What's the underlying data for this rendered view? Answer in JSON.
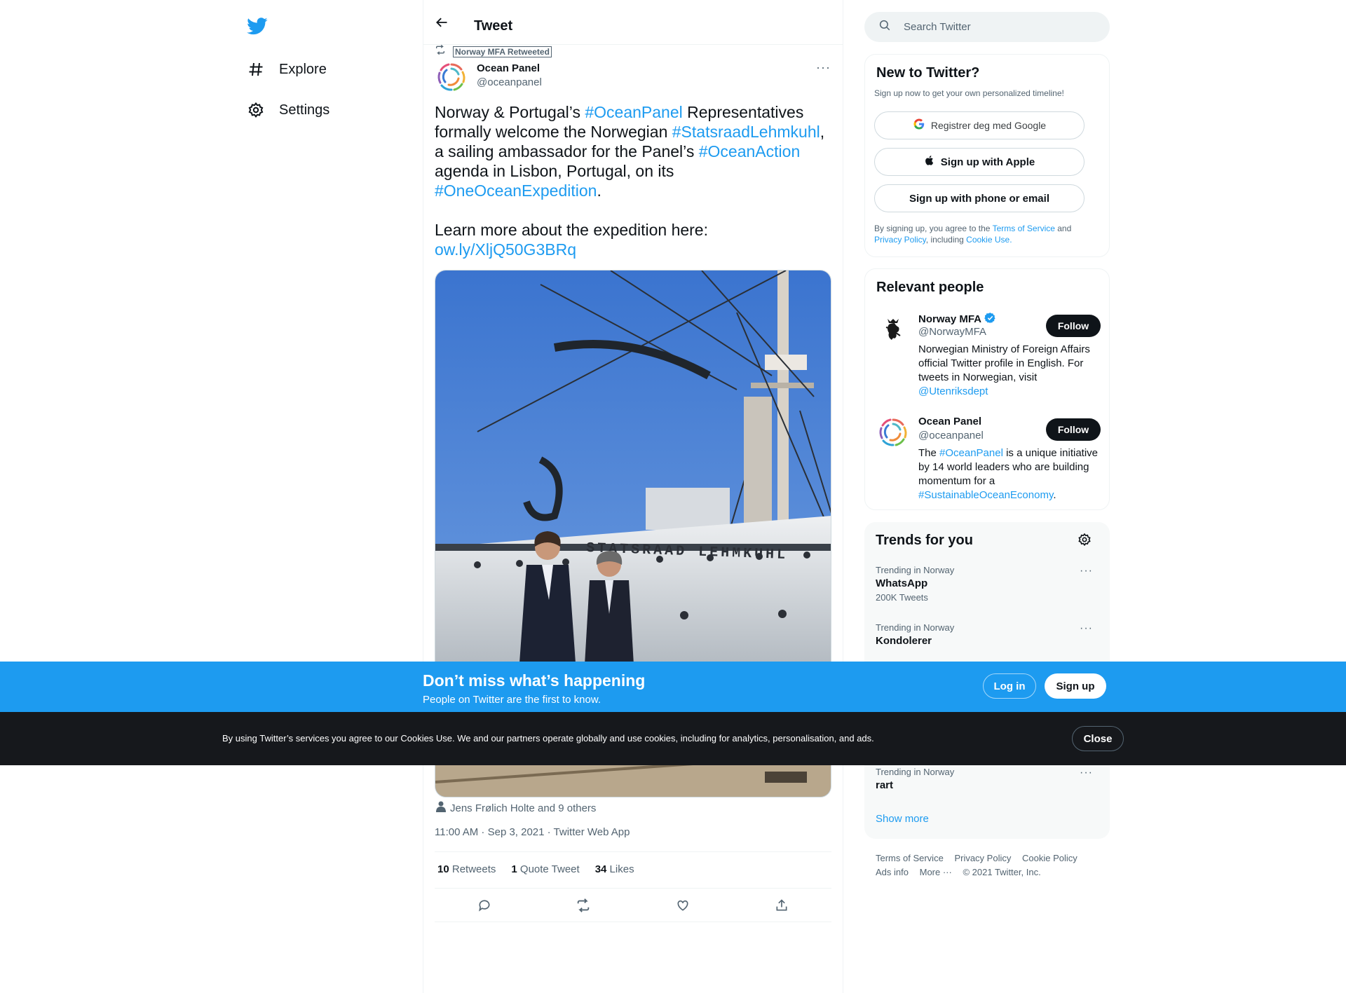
{
  "nav": {
    "logo_icon": "twitter-bird-icon",
    "items": [
      {
        "label": "Explore",
        "icon": "hashtag-icon"
      },
      {
        "label": "Settings",
        "icon": "gear-icon"
      }
    ]
  },
  "header": {
    "title": "Tweet",
    "back_icon": "arrow-left-icon"
  },
  "tweet": {
    "retweeted_by": "Norway MFA Retweeted",
    "author_name": "Ocean Panel",
    "author_handle": "@oceanpanel",
    "text_p1_parts": [
      {
        "t": "Norway & Portugal’s ",
        "link": false
      },
      {
        "t": "#OceanPanel",
        "link": true
      },
      {
        "t": " Representatives formally welcome the Norwegian ",
        "link": false
      },
      {
        "t": "#StatsraadLehmkuhl",
        "link": true
      },
      {
        "t": ", a sailing ambassador for the Panel’s ",
        "link": false
      },
      {
        "t": "#OceanAction",
        "link": true
      },
      {
        "t": " agenda in Lisbon, Portugal, on its ",
        "link": false
      },
      {
        "t": "#OneOceanExpedition",
        "link": true
      },
      {
        "t": ".",
        "link": false
      }
    ],
    "text_p2": "Learn more about the expedition here:",
    "text_link": "ow.ly/XljQ50G3BRq",
    "photo_ship_name": "STATSRAAD LEHMKUHL",
    "tagged": "Jens Frølich Holte and 9 others",
    "timestamp": "11:00 AM · Sep 3, 2021 · Twitter Web App",
    "stats": {
      "retweets_count": "10",
      "retweets_label": "Retweets",
      "quotes_count": "1",
      "quotes_label": "Quote Tweet",
      "likes_count": "34",
      "likes_label": "Likes"
    }
  },
  "search": {
    "placeholder": "Search Twitter"
  },
  "signup_card": {
    "title": "New to Twitter?",
    "subtitle": "Sign up now to get your own personalized timeline!",
    "google": "Registrer deg med Google",
    "apple": "Sign up with Apple",
    "phone": "Sign up with phone or email",
    "legal_1": "By signing up, you agree to the ",
    "legal_tos": "Terms of Service",
    "legal_2": " and ",
    "legal_pp": "Privacy Policy",
    "legal_3": ", including ",
    "legal_cookie": "Cookie Use.",
    "legal_4": ""
  },
  "relevant": {
    "title": "Relevant people",
    "people": [
      {
        "name": "Norway MFA",
        "handle": "@NorwayMFA",
        "bio": "Norwegian Ministry of Foreign Affairs official Twitter profile in English. For tweets in Norwegian, visit ",
        "bio_link": "@Utenriksdept",
        "follow": "Follow",
        "verified": true
      },
      {
        "name": "Ocean Panel",
        "handle": "@oceanpanel",
        "bio_parts": [
          {
            "t": "The ",
            "link": false
          },
          {
            "t": "#OceanPanel",
            "link": true
          },
          {
            "t": " is a unique initiative by 14 world leaders who are building momentum for a ",
            "link": false
          },
          {
            "t": "#SustainableOceanEconomy",
            "link": true
          },
          {
            "t": ".",
            "link": false
          }
        ],
        "follow": "Follow"
      }
    ]
  },
  "trends": {
    "title": "Trends for you",
    "items": [
      {
        "context": "Trending in Norway",
        "name": "WhatsApp",
        "count": "200K Tweets"
      },
      {
        "context": "Trending in Norway",
        "name": "Kondolerer",
        "count": ""
      },
      {
        "context": "Trending in Norway",
        "name": "rart",
        "count": ""
      }
    ],
    "show_more": "Show more"
  },
  "footer": {
    "links_row1": [
      "Terms of Service",
      "Privacy Policy",
      "Cookie Policy"
    ],
    "links_row2": [
      "Ads info",
      "More ···",
      "© 2021 Twitter, Inc."
    ]
  },
  "promo": {
    "title": "Don’t miss what’s happening",
    "subtitle": "People on Twitter are the first to know.",
    "login": "Log in",
    "signup": "Sign up"
  },
  "cookie": {
    "text": "By using Twitter’s services you agree to our Cookies Use. We and our partners operate globally and use cookies, including for analytics, personalisation, and ads.",
    "close": "Close"
  },
  "colors": {
    "accent": "#1d9bf0",
    "text": "#0f1419",
    "muted": "#536471",
    "cookie_bg": "#16181c"
  }
}
